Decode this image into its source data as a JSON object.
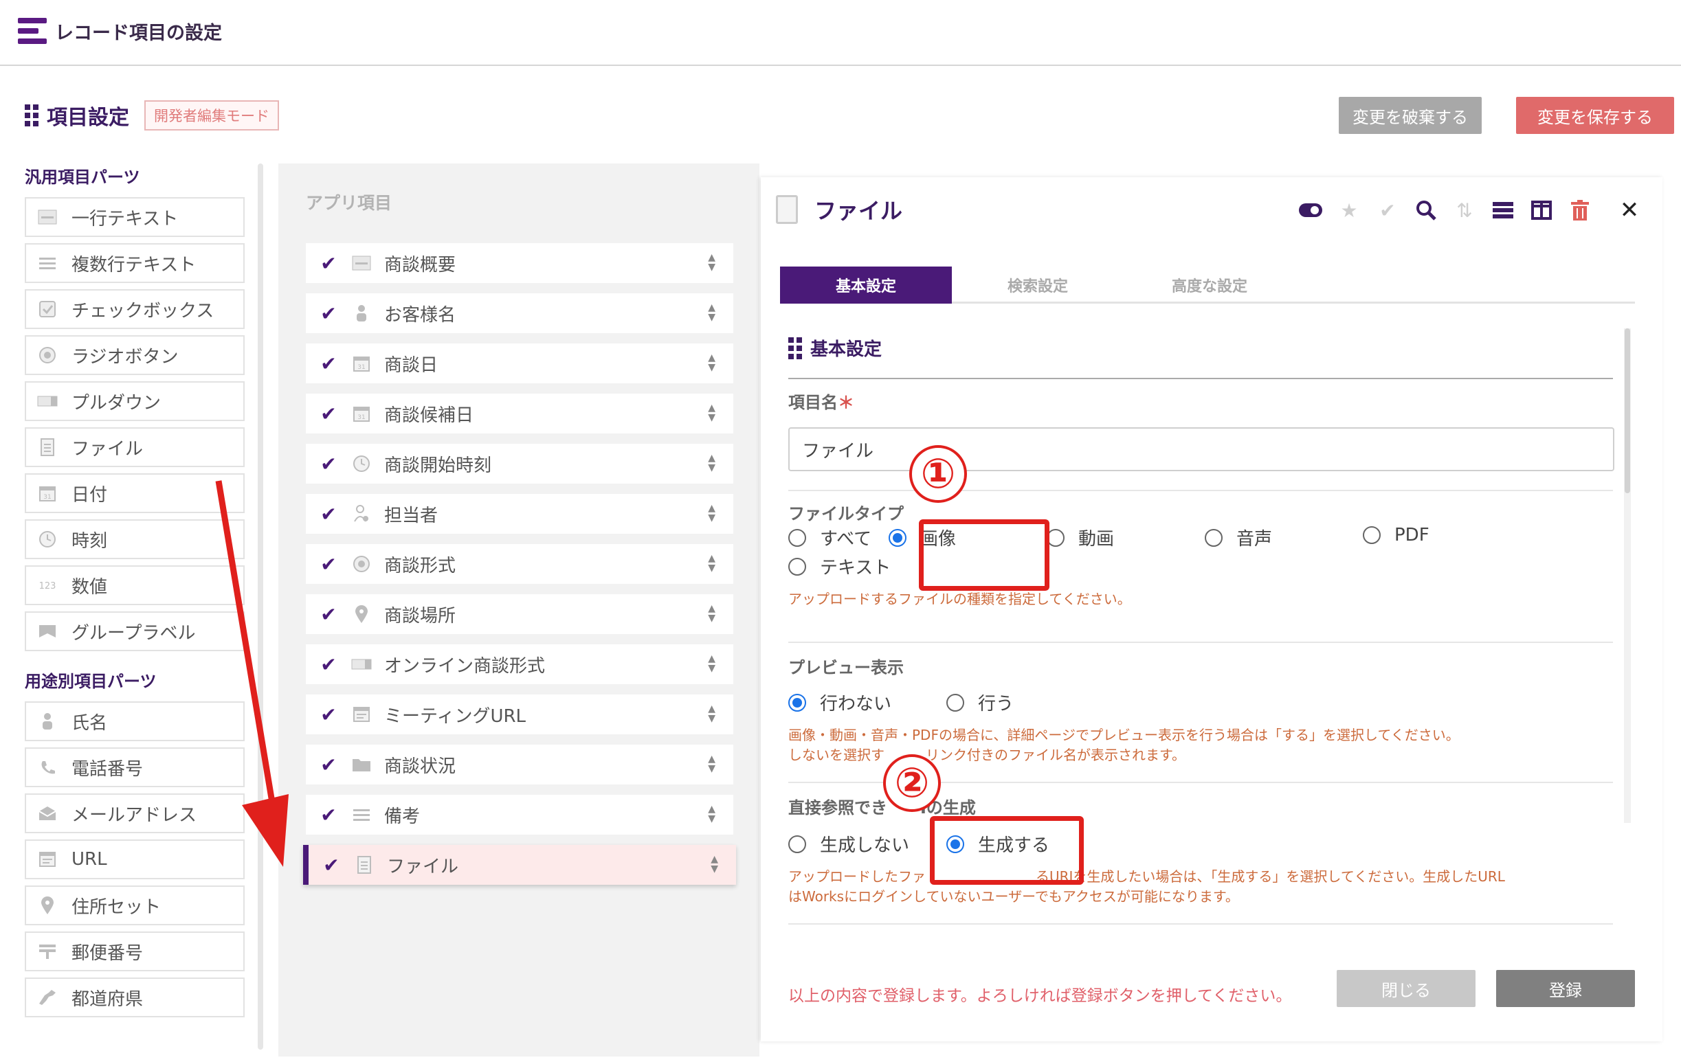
{
  "app": {
    "title": "レコード項目の設定"
  },
  "section": {
    "title": "項目設定",
    "mode_badge": "開発者編集モード"
  },
  "actions": {
    "discard": "変更を破棄する",
    "save": "変更を保存する"
  },
  "palette": {
    "general_title": "汎用項目パーツ",
    "general_items": [
      {
        "label": "一行テキスト",
        "icon": "single-line-icon"
      },
      {
        "label": "複数行テキスト",
        "icon": "multi-line-icon"
      },
      {
        "label": "チェックボックス",
        "icon": "checkbox-icon"
      },
      {
        "label": "ラジオボタン",
        "icon": "radio-icon"
      },
      {
        "label": "プルダウン",
        "icon": "dropdown-icon"
      },
      {
        "label": "ファイル",
        "icon": "file-icon"
      },
      {
        "label": "日付",
        "icon": "calendar-icon"
      },
      {
        "label": "時刻",
        "icon": "clock-icon"
      },
      {
        "label": "数値",
        "icon": "number-icon"
      },
      {
        "label": "グループラベル",
        "icon": "group-label-icon"
      }
    ],
    "purpose_title": "用途別項目パーツ",
    "purpose_items": [
      {
        "label": "氏名",
        "icon": "person-icon"
      },
      {
        "label": "電話番号",
        "icon": "phone-icon"
      },
      {
        "label": "メールアドレス",
        "icon": "mail-icon"
      },
      {
        "label": "URL",
        "icon": "url-icon"
      },
      {
        "label": "住所セット",
        "icon": "pin-icon"
      },
      {
        "label": "郵便番号",
        "icon": "postal-icon"
      },
      {
        "label": "都道府県",
        "icon": "map-icon"
      }
    ]
  },
  "app_items": {
    "title": "アプリ項目",
    "items": [
      {
        "label": "商談概要",
        "icon": "single-line-icon"
      },
      {
        "label": "お客様名",
        "icon": "person-icon"
      },
      {
        "label": "商談日",
        "icon": "calendar-icon"
      },
      {
        "label": "商談候補日",
        "icon": "calendar-icon"
      },
      {
        "label": "商談開始時刻",
        "icon": "clock-icon"
      },
      {
        "label": "担当者",
        "icon": "user-icon"
      },
      {
        "label": "商談形式",
        "icon": "radio-icon"
      },
      {
        "label": "商談場所",
        "icon": "pin-icon"
      },
      {
        "label": "オンライン商談形式",
        "icon": "dropdown-icon"
      },
      {
        "label": "ミーティングURL",
        "icon": "url-icon"
      },
      {
        "label": "商談状況",
        "icon": "folder-icon"
      },
      {
        "label": "備考",
        "icon": "multi-line-icon"
      },
      {
        "label": "ファイル",
        "icon": "file-icon",
        "active": true
      }
    ]
  },
  "panel": {
    "title": "ファイル",
    "tabs": [
      "基本設定",
      "検索設定",
      "高度な設定"
    ],
    "active_tab": "基本設定",
    "form_section": "基本設定",
    "name_label": "項目名",
    "required_mark": "＊",
    "name_value": "ファイル",
    "file_type_label": "ファイルタイプ",
    "file_types": [
      "すべて",
      "画像",
      "動画",
      "音声",
      "PDF",
      "テキスト"
    ],
    "file_type_selected": "画像",
    "file_type_note": "アップロードするファイルの種類を指定してください。",
    "preview_label": "プレビュー表示",
    "preview_options": [
      "行わない",
      "行う"
    ],
    "preview_selected": "行わない",
    "preview_note_1": "画像・動画・音声・PDFの場合に、詳細ページでプレビュー表示を行う場合は「する」を選択してください。",
    "preview_note_2": "しないを選択す　　　リンク付きのファイル名が表示されます。",
    "uri_label": "直接参照でき　　Iの生成",
    "uri_options": [
      "生成しない",
      "生成する"
    ],
    "uri_selected": "生成する",
    "uri_note_1": "アップロードしたファ　　　　　　　　るURIを生成したい場合は、「生成する」を選択してください。生成したURL",
    "uri_note_2": "はWorksにログインしていないユーザーでもアクセスが可能になります。",
    "footer_message": "以上の内容で登録します。よろしければ登録ボタンを押してください。",
    "close_label": "閉じる",
    "register_label": "登録"
  },
  "annotations": {
    "marker_1": "①",
    "marker_2": "②"
  },
  "colors": {
    "brand": "#4a1a78",
    "save": "#e06a6a",
    "annotation": "#e0201c",
    "radio": "#1a73e8"
  }
}
